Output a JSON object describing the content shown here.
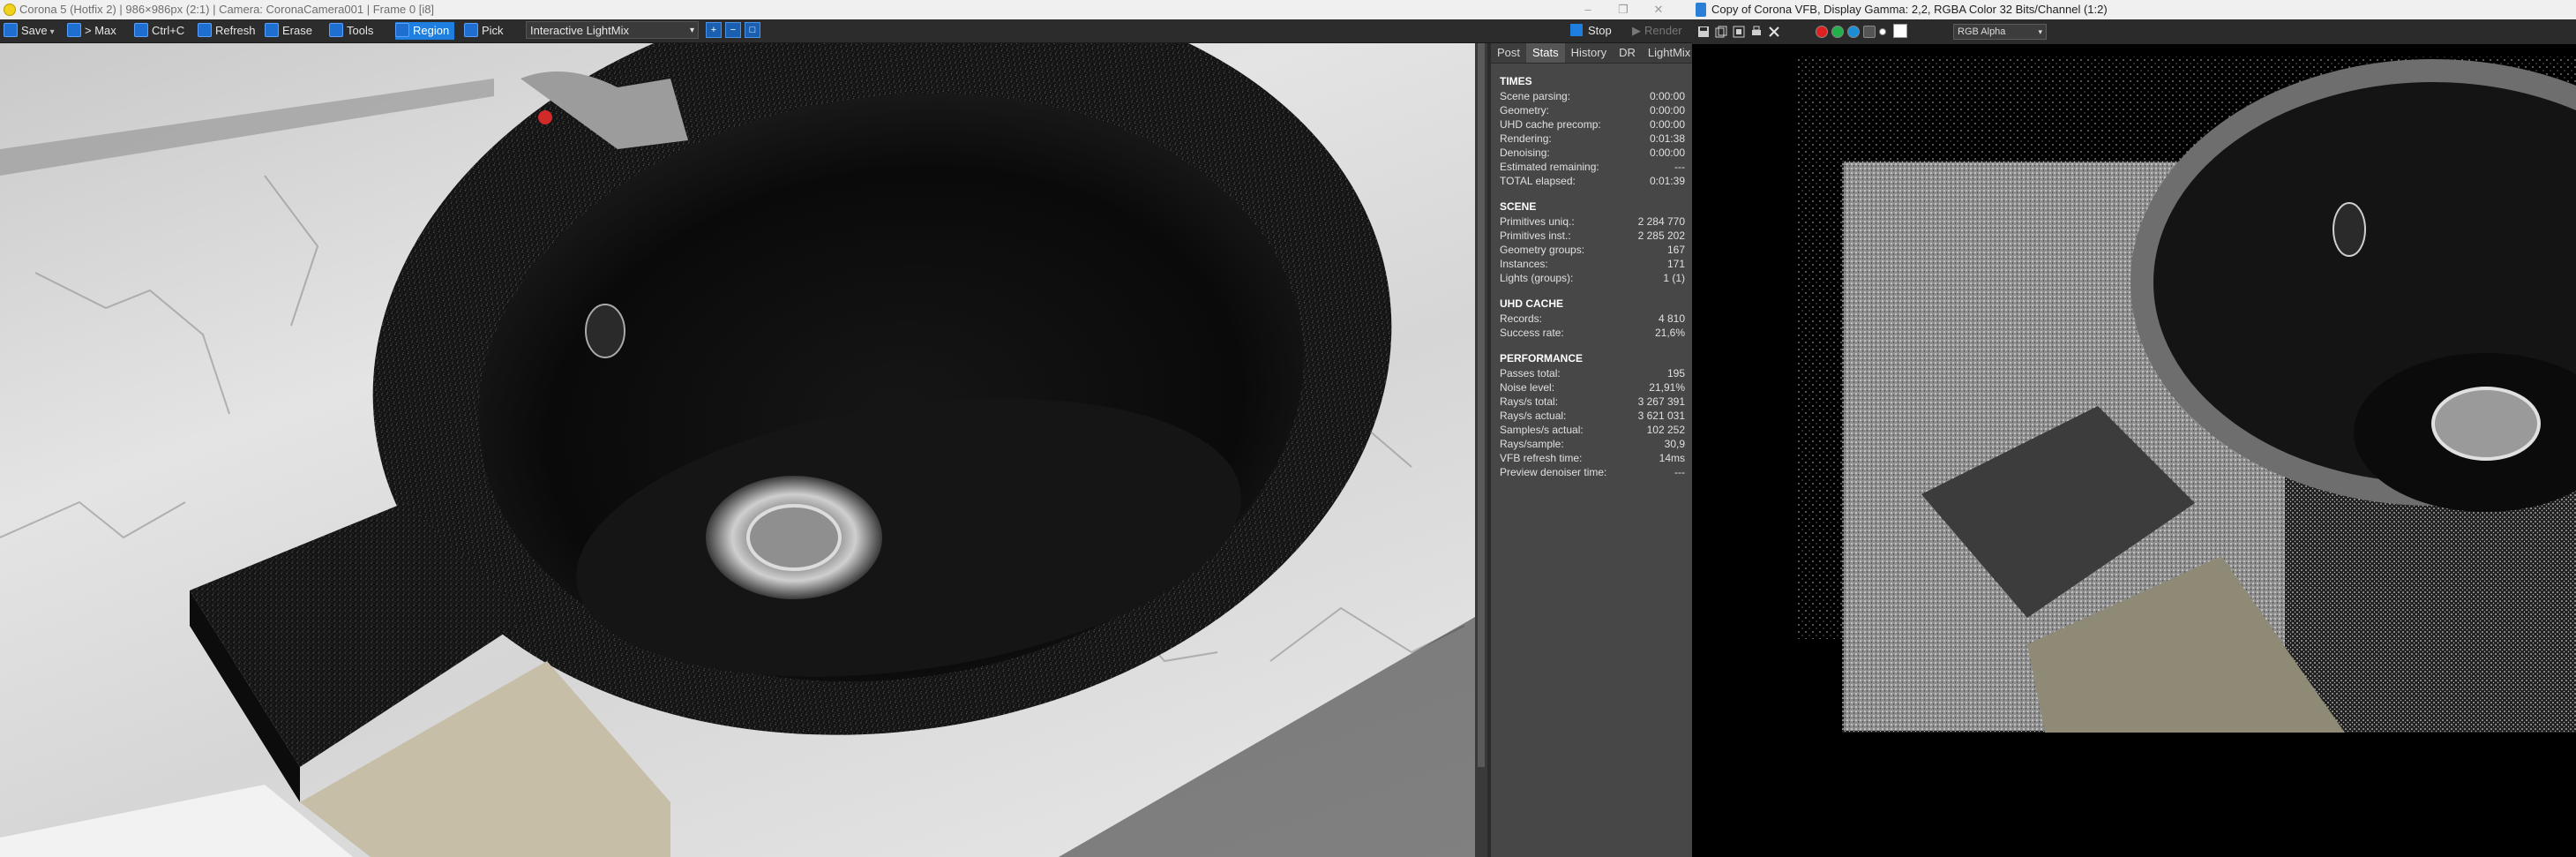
{
  "left_window": {
    "title": "Corona 5 (Hotfix 2) | 986×986px (2:1) | Camera: CoronaCamera001 | Frame 0 [i8]",
    "toolbar": {
      "save": "Save",
      "max": "> Max",
      "copy": "Ctrl+C",
      "refresh": "Refresh",
      "erase": "Erase",
      "tools": "Tools",
      "region": "Region",
      "pick": "Pick",
      "lightmix": "Interactive LightMix"
    },
    "side_panel": {
      "tabs": [
        "Post",
        "Stats",
        "History",
        "DR",
        "LightMix"
      ],
      "active_tab": "Stats",
      "times": {
        "header": "TIMES",
        "rows": [
          {
            "label": "Scene parsing:",
            "value": "0:00:00"
          },
          {
            "label": "Geometry:",
            "value": "0:00:00"
          },
          {
            "label": "UHD cache precomp:",
            "value": "0:00:00"
          },
          {
            "label": "Rendering:",
            "value": "0:01:38"
          },
          {
            "label": "Denoising:",
            "value": "0:00:00"
          },
          {
            "label": "Estimated remaining:",
            "value": "---"
          },
          {
            "label": "TOTAL elapsed:",
            "value": "0:01:39"
          }
        ]
      },
      "scene": {
        "header": "SCENE",
        "rows": [
          {
            "label": "Primitives uniq.:",
            "value": "2 284 770"
          },
          {
            "label": "Primitives inst.:",
            "value": "2 285 202"
          },
          {
            "label": "Geometry groups:",
            "value": "167"
          },
          {
            "label": "Instances:",
            "value": "171"
          },
          {
            "label": "Lights (groups):",
            "value": "1 (1)"
          }
        ]
      },
      "uhd_cache": {
        "header": "UHD CACHE",
        "rows": [
          {
            "label": "Records:",
            "value": "4 810"
          },
          {
            "label": "Success rate:",
            "value": "21,6%"
          }
        ]
      },
      "performance": {
        "header": "PERFORMANCE",
        "rows": [
          {
            "label": "Passes total:",
            "value": "195"
          },
          {
            "label": "Noise level:",
            "value": "21,91%"
          },
          {
            "label": "Rays/s total:",
            "value": "3 267 391"
          },
          {
            "label": "Rays/s actual:",
            "value": "3 621 031"
          },
          {
            "label": "Samples/s actual:",
            "value": "102 252"
          },
          {
            "label": "Rays/sample:",
            "value": "30,9"
          },
          {
            "label": "VFB refresh time:",
            "value": "14ms"
          },
          {
            "label": "Preview denoiser time:",
            "value": "---"
          }
        ]
      }
    }
  },
  "right_window": {
    "title": "Copy of Corona VFB, Display Gamma: 2,2, RGBA Color 32 Bits/Channel (1:2)",
    "toolbar": {
      "stop": "Stop",
      "render": "Render",
      "channel": "RGB Alpha"
    },
    "colors": {
      "accent": "#1f7fe0",
      "red_dot": "#e02020",
      "green_dot": "#22b04a",
      "blue_dot": "#1b8fd6"
    }
  }
}
